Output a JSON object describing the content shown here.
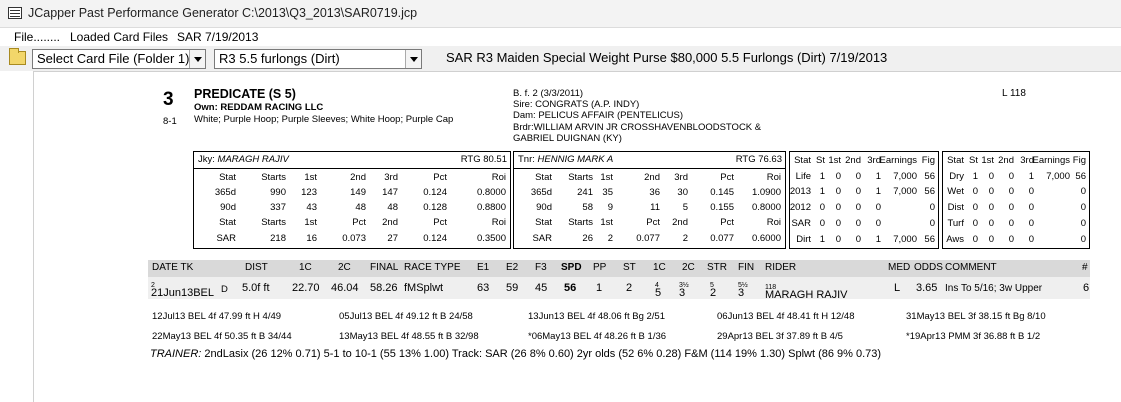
{
  "window": {
    "title": "JCapper Past Performance Generator C:\\2013\\Q3_2013\\SAR0719.jcp"
  },
  "menu": {
    "file": "File........",
    "loaded": "Loaded Card Files",
    "date": "SAR 7/19/2013"
  },
  "toolbar": {
    "card_select": "Select Card File (Folder 1)",
    "race_select": "R3 5.5 furlongs (Dirt)",
    "race_info": "SAR R3  Maiden Special Weight Purse $80,000    5.5 Furlongs (Dirt)  7/19/2013"
  },
  "horse": {
    "number": "3",
    "odds": "8-1",
    "name": "PREDICATE  (S 5)",
    "owner": "Own: REDDAM RACING LLC",
    "silks": "White; Purple Hoop; Purple Sleeves; White Hoop; Purple Cap",
    "sex_age": "B. f. 2 (3/3/2011)",
    "sire": "Sire: CONGRATS (A.P. INDY)",
    "dam": "Dam: PELICUS AFFAIR (PENTELICUS)",
    "breeder_1": "Brdr:WILLIAM ARVIN JR CROSSHAVENBLOODSTOCK &",
    "breeder_2": "GABRIEL DUIGNAN (KY)",
    "weight": "L 118"
  },
  "jockey": {
    "label": "Jky:",
    "name": "MARAGH RAJIV",
    "rtg": "RTG 80.51",
    "rows": [
      [
        "Stat",
        "Starts",
        "1st",
        "2nd",
        "3rd",
        "Pct",
        "Roi"
      ],
      [
        "365d",
        "990",
        "123",
        "149",
        "147",
        "0.124",
        "0.8000"
      ],
      [
        "90d",
        "337",
        "43",
        "48",
        "48",
        "0.128",
        "0.8800"
      ],
      [
        "Stat",
        "Starts",
        "1st",
        "Pct",
        "2nd",
        "Pct",
        "Roi"
      ],
      [
        "SAR",
        "218",
        "16",
        "0.073",
        "27",
        "0.124",
        "0.3500"
      ]
    ]
  },
  "trainer": {
    "label": "Tnr:",
    "name": "HENNIG MARK A",
    "rtg": "RTG 76.63",
    "rows": [
      [
        "Stat",
        "Starts",
        "1st",
        "2nd",
        "3rd",
        "Pct",
        "Roi"
      ],
      [
        "365d",
        "241",
        "35",
        "36",
        "30",
        "0.145",
        "1.0900"
      ],
      [
        "90d",
        "58",
        "9",
        "11",
        "5",
        "0.155",
        "0.8000"
      ],
      [
        "Stat",
        "Starts",
        "1st",
        "Pct",
        "2nd",
        "Pct",
        "Roi"
      ],
      [
        "SAR",
        "26",
        "2",
        "0.077",
        "2",
        "0.077",
        "0.6000"
      ]
    ]
  },
  "record1": {
    "rows": [
      [
        "Stat",
        "St",
        "1st",
        "2nd",
        "3rd",
        "Earnings",
        "Fig"
      ],
      [
        "Life",
        "1",
        "0",
        "0",
        "1",
        "7,000",
        "56"
      ],
      [
        "2013",
        "1",
        "0",
        "0",
        "1",
        "7,000",
        "56"
      ],
      [
        "2012",
        "0",
        "0",
        "0",
        "0",
        "",
        "0"
      ],
      [
        "SAR",
        "0",
        "0",
        "0",
        "0",
        "",
        "0"
      ],
      [
        "Dirt",
        "1",
        "0",
        "0",
        "1",
        "7,000",
        "56"
      ]
    ]
  },
  "record2": {
    "rows": [
      [
        "Stat",
        "St",
        "1st",
        "2nd",
        "3rd",
        "Earnings",
        "Fig"
      ],
      [
        "Dry",
        "1",
        "0",
        "0",
        "1",
        "7,000",
        "56"
      ],
      [
        "Wet",
        "0",
        "0",
        "0",
        "0",
        "",
        "0"
      ],
      [
        "Dist",
        "0",
        "0",
        "0",
        "0",
        "",
        "0"
      ],
      [
        "Turf",
        "0",
        "0",
        "0",
        "0",
        "",
        "0"
      ],
      [
        "Aws",
        "0",
        "0",
        "0",
        "0",
        "",
        "0"
      ]
    ]
  },
  "pp_header": [
    "DATE TK",
    "DIST",
    "1C",
    "2C",
    "FINAL",
    "RACE TYPE",
    "E1",
    "E2",
    "F3",
    "SPD",
    "PP",
    "ST",
    "1C",
    "2C",
    "STR",
    "FIN",
    "RIDER",
    "MED",
    "ODDS",
    "COMMENT",
    "#"
  ],
  "pp_line": {
    "date": "21Jun13BEL",
    "date_sup": "2",
    "surface": "D",
    "dist": "5.0f ft",
    "c1": "22.70",
    "c2": "46.04",
    "final": "58.26",
    "race_type": "fMSplwt",
    "e1": "63",
    "e2": "59",
    "f3": "45",
    "spd": "56",
    "pp": "1",
    "st": "2",
    "call1": "5",
    "call1_sup": "4",
    "call2": "3",
    "call2_sup": "3½",
    "str": "2",
    "str_sup": "5",
    "fin": "3",
    "fin_sup": "5½",
    "rider": "MARAGH RAJIV",
    "rider_sup": "118",
    "med": "L",
    "odds": "3.65",
    "comment": "Ins To 5/16; 3w Upper",
    "num": "6"
  },
  "workouts": [
    "12Jul13 BEL 4f 47.99 ft H 4/49",
    "05Jul13 BEL 4f 49.12 ft B 24/58",
    "13Jun13 BEL 4f 48.06 ft Bg 2/51",
    "06Jun13 BEL 4f 48.41 ft H 12/48",
    "31May13 BEL 3f 38.15 ft Bg 8/10",
    "22May13 BEL 4f 50.35 ft B 34/44",
    "13May13 BEL 4f 48.55 ft B 32/98",
    "*06May13 BEL 4f 48.26 ft B 1/36",
    "29Apr13 BEL 3f 37.89 ft B 4/5",
    "*19Apr13 PMM 3f 36.88 ft B 1/2"
  ],
  "trainer_line": {
    "label": "TRAINER:",
    "stats": "2ndLasix (26 12% 0.71)  5-1 to 10-1 (55 13% 1.00)  Track: SAR (26 8% 0.60)  2yr olds (52 6% 0.28)  F&M (114 19% 1.30)  Splwt (86 9% 0.73)"
  }
}
